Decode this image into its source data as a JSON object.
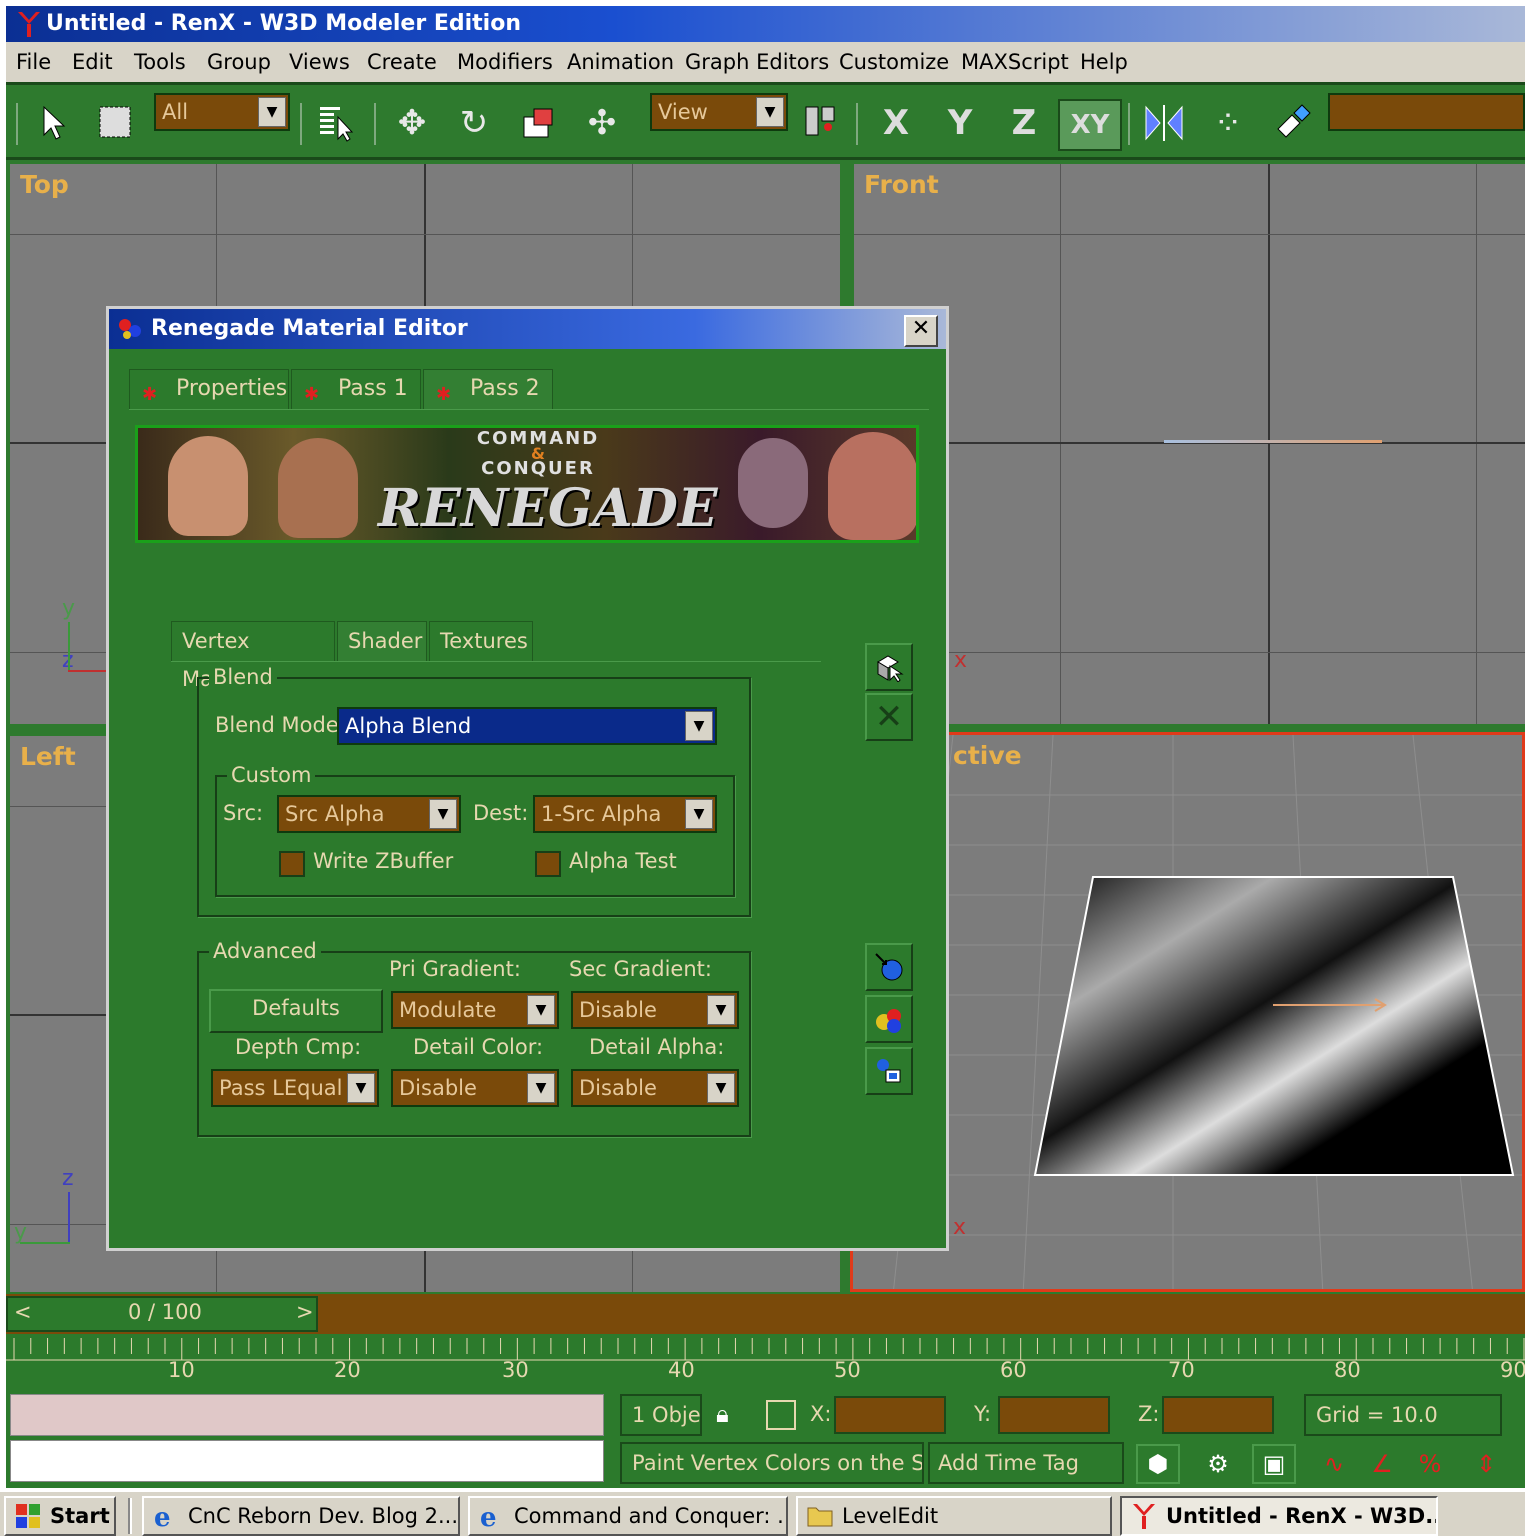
{
  "window": {
    "title": "Untitled - RenX - W3D Modeler Edition"
  },
  "menu": [
    "File",
    "Edit",
    "Tools",
    "Group",
    "Views",
    "Create",
    "Modifiers",
    "Animation",
    "Graph Editors",
    "Customize",
    "MAXScript",
    "Help"
  ],
  "toolbar": {
    "selection_filter": "All",
    "ref_coord": "View",
    "axis_x": "X",
    "axis_y": "Y",
    "axis_z": "Z",
    "axis_xy": "XY"
  },
  "viewports": {
    "top": "Top",
    "front": "Front",
    "left": "Left",
    "perspective": "ctive"
  },
  "axes": {
    "y": "y",
    "z": "z",
    "x": "x"
  },
  "dialog": {
    "title": "Renegade Material Editor",
    "close": "✕",
    "tabs": [
      "Properties",
      "Pass 1",
      "Pass 2"
    ],
    "banner": {
      "line1": "COMMAND",
      "line2": "CONQUER",
      "line3": "RENEGADE",
      "amp": "&"
    },
    "subtabs": [
      "Vertex Material",
      "Shader",
      "Textures"
    ],
    "blend": {
      "group": "Blend",
      "mode_label": "Blend Mode:",
      "mode_value": "Alpha Blend",
      "custom_group": "Custom",
      "src_label": "Src:",
      "src_value": "Src Alpha",
      "dest_label": "Dest:",
      "dest_value": "1-Src Alpha",
      "write_zbuffer": "Write ZBuffer",
      "alpha_test": "Alpha Test"
    },
    "advanced": {
      "group": "Advanced",
      "pri_gradient_label": "Pri Gradient:",
      "sec_gradient_label": "Sec Gradient:",
      "defaults_button": "Defaults",
      "pri_gradient_value": "Modulate",
      "sec_gradient_value": "Disable",
      "depth_cmp_label": "Depth Cmp:",
      "detail_color_label": "Detail Color:",
      "detail_alpha_label": "Detail Alpha:",
      "depth_cmp_value": "Pass LEqual",
      "detail_color_value": "Disable",
      "detail_alpha_value": "Disable"
    }
  },
  "timeline": {
    "frame": "0 / 100",
    "prev": "<",
    "next": ">",
    "ticks": [
      "10",
      "20",
      "30",
      "40",
      "50",
      "60",
      "70",
      "80",
      "90"
    ]
  },
  "status": {
    "selection": "1 Obje",
    "x_label": "X:",
    "y_label": "Y:",
    "z_label": "Z:",
    "grid": "Grid = 10.0",
    "prompt": "Paint Vertex Colors on the Sele",
    "add_time_tag": "Add Time Tag"
  },
  "taskbar": {
    "start": "Start",
    "tasks": [
      "CnC Reborn Dev. Blog 2...",
      "Command and Conquer: ...",
      "LevelEdit",
      "Untitled - RenX - W3D..."
    ]
  },
  "colors": {
    "toolbar_green": "#2e7a2e",
    "field_brown": "#7a4a0a",
    "viewport_label": "#e8b04a",
    "title_blue": "#0b2f93"
  }
}
